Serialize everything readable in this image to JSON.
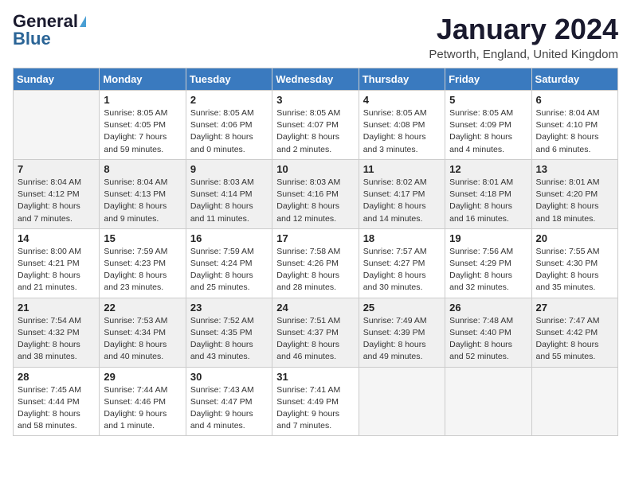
{
  "logo": {
    "general": "General",
    "blue": "Blue"
  },
  "title": "January 2024",
  "location": "Petworth, England, United Kingdom",
  "days_of_week": [
    "Sunday",
    "Monday",
    "Tuesday",
    "Wednesday",
    "Thursday",
    "Friday",
    "Saturday"
  ],
  "weeks": [
    [
      {
        "num": "",
        "sunrise": "",
        "sunset": "",
        "daylight": ""
      },
      {
        "num": "1",
        "sunrise": "Sunrise: 8:05 AM",
        "sunset": "Sunset: 4:05 PM",
        "daylight": "Daylight: 7 hours and 59 minutes."
      },
      {
        "num": "2",
        "sunrise": "Sunrise: 8:05 AM",
        "sunset": "Sunset: 4:06 PM",
        "daylight": "Daylight: 8 hours and 0 minutes."
      },
      {
        "num": "3",
        "sunrise": "Sunrise: 8:05 AM",
        "sunset": "Sunset: 4:07 PM",
        "daylight": "Daylight: 8 hours and 2 minutes."
      },
      {
        "num": "4",
        "sunrise": "Sunrise: 8:05 AM",
        "sunset": "Sunset: 4:08 PM",
        "daylight": "Daylight: 8 hours and 3 minutes."
      },
      {
        "num": "5",
        "sunrise": "Sunrise: 8:05 AM",
        "sunset": "Sunset: 4:09 PM",
        "daylight": "Daylight: 8 hours and 4 minutes."
      },
      {
        "num": "6",
        "sunrise": "Sunrise: 8:04 AM",
        "sunset": "Sunset: 4:10 PM",
        "daylight": "Daylight: 8 hours and 6 minutes."
      }
    ],
    [
      {
        "num": "7",
        "sunrise": "Sunrise: 8:04 AM",
        "sunset": "Sunset: 4:12 PM",
        "daylight": "Daylight: 8 hours and 7 minutes."
      },
      {
        "num": "8",
        "sunrise": "Sunrise: 8:04 AM",
        "sunset": "Sunset: 4:13 PM",
        "daylight": "Daylight: 8 hours and 9 minutes."
      },
      {
        "num": "9",
        "sunrise": "Sunrise: 8:03 AM",
        "sunset": "Sunset: 4:14 PM",
        "daylight": "Daylight: 8 hours and 11 minutes."
      },
      {
        "num": "10",
        "sunrise": "Sunrise: 8:03 AM",
        "sunset": "Sunset: 4:16 PM",
        "daylight": "Daylight: 8 hours and 12 minutes."
      },
      {
        "num": "11",
        "sunrise": "Sunrise: 8:02 AM",
        "sunset": "Sunset: 4:17 PM",
        "daylight": "Daylight: 8 hours and 14 minutes."
      },
      {
        "num": "12",
        "sunrise": "Sunrise: 8:01 AM",
        "sunset": "Sunset: 4:18 PM",
        "daylight": "Daylight: 8 hours and 16 minutes."
      },
      {
        "num": "13",
        "sunrise": "Sunrise: 8:01 AM",
        "sunset": "Sunset: 4:20 PM",
        "daylight": "Daylight: 8 hours and 18 minutes."
      }
    ],
    [
      {
        "num": "14",
        "sunrise": "Sunrise: 8:00 AM",
        "sunset": "Sunset: 4:21 PM",
        "daylight": "Daylight: 8 hours and 21 minutes."
      },
      {
        "num": "15",
        "sunrise": "Sunrise: 7:59 AM",
        "sunset": "Sunset: 4:23 PM",
        "daylight": "Daylight: 8 hours and 23 minutes."
      },
      {
        "num": "16",
        "sunrise": "Sunrise: 7:59 AM",
        "sunset": "Sunset: 4:24 PM",
        "daylight": "Daylight: 8 hours and 25 minutes."
      },
      {
        "num": "17",
        "sunrise": "Sunrise: 7:58 AM",
        "sunset": "Sunset: 4:26 PM",
        "daylight": "Daylight: 8 hours and 28 minutes."
      },
      {
        "num": "18",
        "sunrise": "Sunrise: 7:57 AM",
        "sunset": "Sunset: 4:27 PM",
        "daylight": "Daylight: 8 hours and 30 minutes."
      },
      {
        "num": "19",
        "sunrise": "Sunrise: 7:56 AM",
        "sunset": "Sunset: 4:29 PM",
        "daylight": "Daylight: 8 hours and 32 minutes."
      },
      {
        "num": "20",
        "sunrise": "Sunrise: 7:55 AM",
        "sunset": "Sunset: 4:30 PM",
        "daylight": "Daylight: 8 hours and 35 minutes."
      }
    ],
    [
      {
        "num": "21",
        "sunrise": "Sunrise: 7:54 AM",
        "sunset": "Sunset: 4:32 PM",
        "daylight": "Daylight: 8 hours and 38 minutes."
      },
      {
        "num": "22",
        "sunrise": "Sunrise: 7:53 AM",
        "sunset": "Sunset: 4:34 PM",
        "daylight": "Daylight: 8 hours and 40 minutes."
      },
      {
        "num": "23",
        "sunrise": "Sunrise: 7:52 AM",
        "sunset": "Sunset: 4:35 PM",
        "daylight": "Daylight: 8 hours and 43 minutes."
      },
      {
        "num": "24",
        "sunrise": "Sunrise: 7:51 AM",
        "sunset": "Sunset: 4:37 PM",
        "daylight": "Daylight: 8 hours and 46 minutes."
      },
      {
        "num": "25",
        "sunrise": "Sunrise: 7:49 AM",
        "sunset": "Sunset: 4:39 PM",
        "daylight": "Daylight: 8 hours and 49 minutes."
      },
      {
        "num": "26",
        "sunrise": "Sunrise: 7:48 AM",
        "sunset": "Sunset: 4:40 PM",
        "daylight": "Daylight: 8 hours and 52 minutes."
      },
      {
        "num": "27",
        "sunrise": "Sunrise: 7:47 AM",
        "sunset": "Sunset: 4:42 PM",
        "daylight": "Daylight: 8 hours and 55 minutes."
      }
    ],
    [
      {
        "num": "28",
        "sunrise": "Sunrise: 7:45 AM",
        "sunset": "Sunset: 4:44 PM",
        "daylight": "Daylight: 8 hours and 58 minutes."
      },
      {
        "num": "29",
        "sunrise": "Sunrise: 7:44 AM",
        "sunset": "Sunset: 4:46 PM",
        "daylight": "Daylight: 9 hours and 1 minute."
      },
      {
        "num": "30",
        "sunrise": "Sunrise: 7:43 AM",
        "sunset": "Sunset: 4:47 PM",
        "daylight": "Daylight: 9 hours and 4 minutes."
      },
      {
        "num": "31",
        "sunrise": "Sunrise: 7:41 AM",
        "sunset": "Sunset: 4:49 PM",
        "daylight": "Daylight: 9 hours and 7 minutes."
      },
      {
        "num": "",
        "sunrise": "",
        "sunset": "",
        "daylight": ""
      },
      {
        "num": "",
        "sunrise": "",
        "sunset": "",
        "daylight": ""
      },
      {
        "num": "",
        "sunrise": "",
        "sunset": "",
        "daylight": ""
      }
    ]
  ]
}
